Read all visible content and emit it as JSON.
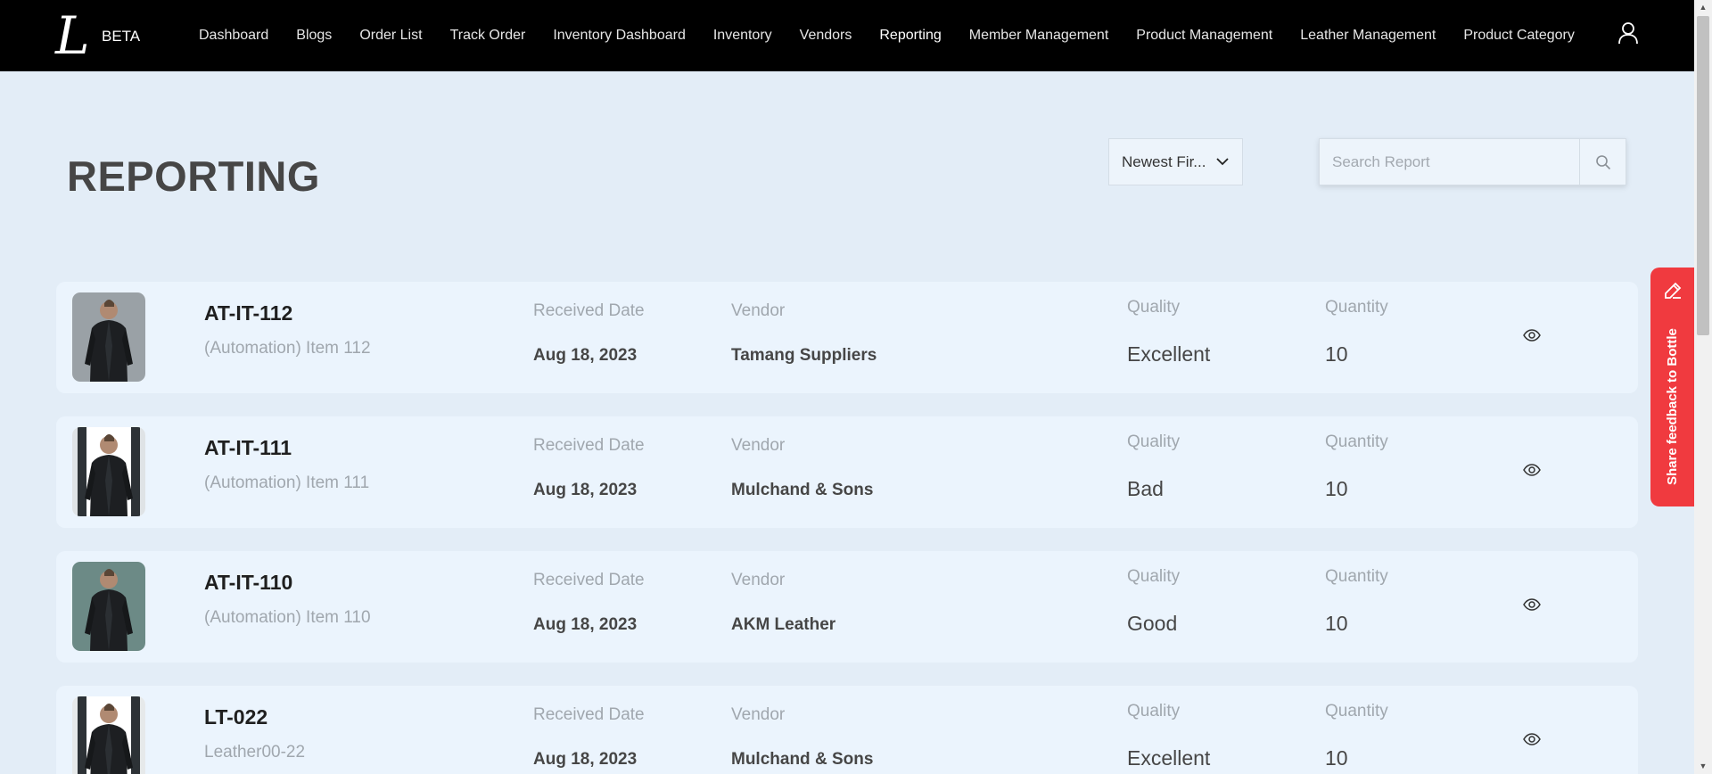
{
  "brand": {
    "logo": "L",
    "badge": "BETA"
  },
  "nav": {
    "items": [
      {
        "label": "Dashboard",
        "active": false
      },
      {
        "label": "Blogs",
        "active": false
      },
      {
        "label": "Order List",
        "active": false
      },
      {
        "label": "Track Order",
        "active": false
      },
      {
        "label": "Inventory Dashboard",
        "active": false
      },
      {
        "label": "Inventory",
        "active": false
      },
      {
        "label": "Vendors",
        "active": false
      },
      {
        "label": "Reporting",
        "active": true
      },
      {
        "label": "Member Management",
        "active": false
      },
      {
        "label": "Product Management",
        "active": false
      },
      {
        "label": "Leather Management",
        "active": false
      },
      {
        "label": "Product Category",
        "active": false
      }
    ],
    "user_icon": "user-icon"
  },
  "page": {
    "title": "REPORTING",
    "sort": {
      "selected": "Newest First",
      "display": "Newest Fir..."
    },
    "search": {
      "placeholder": "Search Report",
      "value": ""
    }
  },
  "labels": {
    "received_date": "Received Date",
    "vendor": "Vendor",
    "quality": "Quality",
    "quantity": "Quantity"
  },
  "reports": [
    {
      "code": "AT-IT-112",
      "name": "(Automation) Item 112",
      "received_date": "Aug 18, 2023",
      "vendor": "Tamang Suppliers",
      "quality": "Excellent",
      "quantity": "10"
    },
    {
      "code": "AT-IT-111",
      "name": "(Automation) Item 111",
      "received_date": "Aug 18, 2023",
      "vendor": "Mulchand & Sons",
      "quality": "Bad",
      "quantity": "10"
    },
    {
      "code": "AT-IT-110",
      "name": "(Automation) Item 110",
      "received_date": "Aug 18, 2023",
      "vendor": "AKM Leather",
      "quality": "Good",
      "quantity": "10"
    },
    {
      "code": "LT-022",
      "name": "Leather00-22",
      "received_date": "Aug 18, 2023",
      "vendor": "Mulchand & Sons",
      "quality": "Excellent",
      "quantity": "10"
    }
  ],
  "feedback": {
    "label": "Share feedback to Bottle",
    "color": "#f03a3f"
  },
  "colors": {
    "navbar": "#000000",
    "background": "#e3edf7",
    "card": "#ebf4fd"
  }
}
